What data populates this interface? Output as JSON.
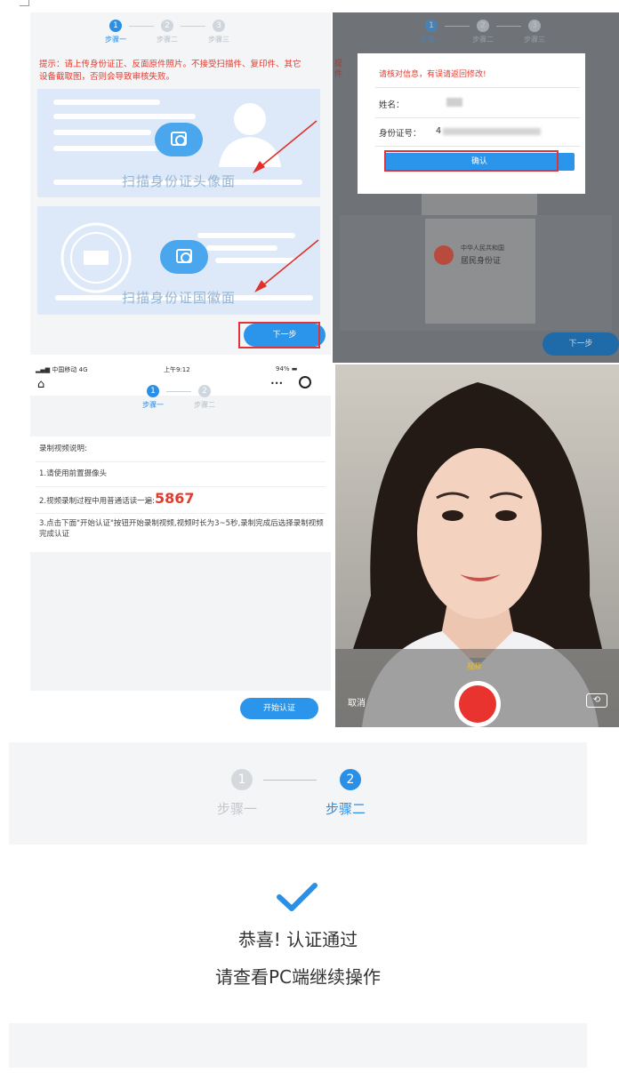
{
  "steps": {
    "step1": "步骤一",
    "step2": "步骤二",
    "step3": "步骤三",
    "n1": "1",
    "n2": "2",
    "n3": "3"
  },
  "upload_screen": {
    "tip": "提示：请上传身份证正、反面原件照片。不接受扫描件、复印件、其它设备截取图，否则会导致审核失败。",
    "front_card_label": "扫描身份证头像面",
    "back_card_label": "扫描身份证国徽面",
    "next_button": "下一步"
  },
  "confirm_screen": {
    "dialog_title": "请核对信息，有误请返回修改!",
    "name_label": "姓名：",
    "name_value": "",
    "id_label": "身份证号：",
    "id_value": "4",
    "confirm_button": "确认",
    "next_button": "下一步",
    "id_card_line1": "中华人民共和国",
    "id_card_line2": "居民身份证",
    "tip_fragment": "提\n件"
  },
  "video_screen": {
    "carrier": "中国移动",
    "network": "4G",
    "time": "上午9:12",
    "battery": "94%",
    "more_icon_text": "•••",
    "section_title": "录制视频说明:",
    "item1": "1.请使用前置摄像头",
    "item2": "2.视频录制过程中用普通话读一遍:",
    "code": "5867",
    "item3": "3.点击下面\"开始认证\"按钮开始录制视频,视频时长为3~5秒,录制完成后选择录制视频完成认证",
    "start_button": "开始认证"
  },
  "camera_screen": {
    "mode_label": "视频",
    "cancel": "取消"
  },
  "result_screen": {
    "success_title": "恭喜! 认证通过",
    "success_sub": "请查看PC端继续操作"
  },
  "colors": {
    "primary": "#2a8fe6",
    "warning": "#e23b2f",
    "record": "#e8332e"
  }
}
